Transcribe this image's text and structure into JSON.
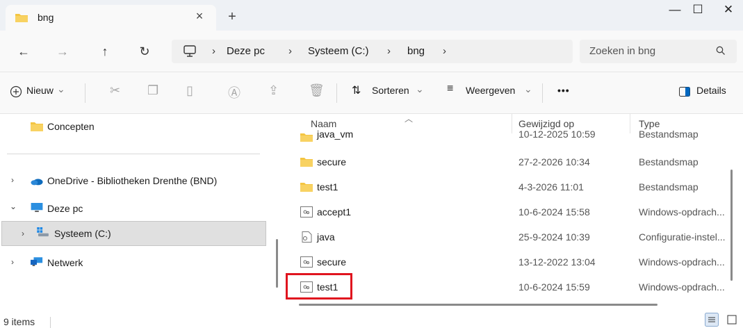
{
  "tab": {
    "title": "bng",
    "close": "×",
    "new": "+"
  },
  "window": {
    "minimize": "—",
    "maximize": "☐",
    "close": "✕"
  },
  "nav": {
    "back": "←",
    "forward": "→",
    "up": "↑",
    "refresh": "↻"
  },
  "breadcrumb": {
    "items": [
      "Deze pc",
      "Systeem (C:)",
      "bng"
    ],
    "separator": "›"
  },
  "search": {
    "placeholder": "Zoeken in bng"
  },
  "toolbar": {
    "new_label": "Nieuw",
    "sort_label": "Sorteren",
    "view_label": "Weergeven",
    "more_label": "•••",
    "details_label": "Details",
    "dropdown": "⌄"
  },
  "sidebar": {
    "items": [
      {
        "label": "Concepten",
        "icon": "folder-icon"
      },
      {
        "label": "OneDrive - Bibliotheken Drenthe (BND)",
        "icon": "cloud-icon"
      },
      {
        "label": "Deze pc",
        "icon": "computer-icon"
      },
      {
        "label": "Systeem (C:)",
        "icon": "drive-icon"
      },
      {
        "label": "Netwerk",
        "icon": "network-icon"
      }
    ]
  },
  "columns": {
    "name": "Naam",
    "modified": "Gewijzigd op",
    "type": "Type"
  },
  "files": [
    {
      "name": "java_vm",
      "modified": "10-12-2025 10:59",
      "type": "Bestandsmap",
      "icon": "folder-icon"
    },
    {
      "name": "secure",
      "modified": "27-2-2026 10:34",
      "type": "Bestandsmap",
      "icon": "folder-icon"
    },
    {
      "name": "test1",
      "modified": "4-3-2026 11:01",
      "type": "Bestandsmap",
      "icon": "folder-icon"
    },
    {
      "name": "accept1",
      "modified": "10-6-2024 15:58",
      "type": "Windows-opdrach...",
      "icon": "batch-file-icon"
    },
    {
      "name": "java",
      "modified": "25-9-2024 10:39",
      "type": "Configuratie-instel...",
      "icon": "config-file-icon"
    },
    {
      "name": "secure",
      "modified": "13-12-2022 13:04",
      "type": "Windows-opdrach...",
      "icon": "batch-file-icon"
    },
    {
      "name": "test1",
      "modified": "10-6-2024 15:59",
      "type": "Windows-opdrach...",
      "icon": "batch-file-icon"
    }
  ],
  "status": {
    "count": "9 items"
  },
  "colors": {
    "folder": "#f4c542",
    "highlight": "#e0141e",
    "selected_row": "#e0e0e0",
    "accent": "#0067c0"
  }
}
